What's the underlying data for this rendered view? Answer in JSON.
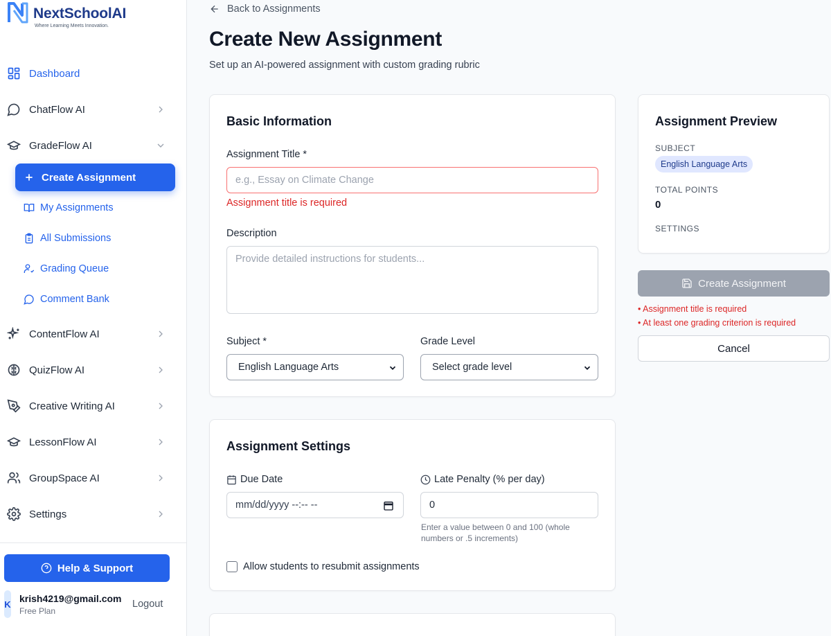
{
  "brand": {
    "name": "NextSchoolAI",
    "tagline": "Where Learning Meets Innovation."
  },
  "sidebar": {
    "items": [
      {
        "label": "Dashboard",
        "icon": "grid-icon"
      },
      {
        "label": "ChatFlow AI",
        "icon": "chat-bubble-icon"
      },
      {
        "label": "GradeFlow AI",
        "icon": "graduation-cap-icon"
      },
      {
        "label": "ContentFlow AI",
        "icon": "sparkles-icon"
      },
      {
        "label": "QuizFlow AI",
        "icon": "brain-icon"
      },
      {
        "label": "Creative Writing AI",
        "icon": "pen-tool-icon"
      },
      {
        "label": "LessonFlow AI",
        "icon": "graduation-cap-icon"
      },
      {
        "label": "GroupSpace AI",
        "icon": "users-icon"
      },
      {
        "label": "Settings",
        "icon": "gear-icon"
      }
    ],
    "subitems": [
      {
        "label": "Create Assignment",
        "icon": "plus-icon"
      },
      {
        "label": "My Assignments",
        "icon": "book-open-icon"
      },
      {
        "label": "All Submissions",
        "icon": "clipboard-icon"
      },
      {
        "label": "Grading Queue",
        "icon": "user-check-icon"
      },
      {
        "label": "Comment Bank",
        "icon": "chat-bubble-icon"
      }
    ],
    "help_label": "Help & Support",
    "user": {
      "avatar_letter": "K",
      "email": "krish4219@gmail.com",
      "plan": "Free Plan",
      "logout_label": "Logout"
    }
  },
  "header": {
    "back_label": "Back to Assignments",
    "title": "Create New Assignment",
    "subtitle": "Set up an AI-powered assignment with custom grading rubric"
  },
  "basic_info": {
    "title": "Basic Information",
    "title_label": "Assignment Title *",
    "title_placeholder": "e.g., Essay on Climate Change",
    "title_value": "",
    "title_error": "Assignment title is required",
    "description_label": "Description",
    "description_placeholder": "Provide detailed instructions for students...",
    "subject_label": "Subject *",
    "subject_value": "English Language Arts",
    "grade_label": "Grade Level",
    "grade_value": "Select grade level"
  },
  "settings": {
    "title": "Assignment Settings",
    "due_label": "Due Date",
    "due_placeholder": "mm/dd/yyyy --:-- --",
    "penalty_label": "Late Penalty (% per day)",
    "penalty_value": "0",
    "penalty_hint_1": "Enter a value between 0 and 100 (whole",
    "penalty_hint_2": "numbers or .5 increments)",
    "resubmit_label": "Allow students to resubmit assignments",
    "resubmit_checked": false
  },
  "preview": {
    "title": "Assignment Preview",
    "subject_label": "SUBJECT",
    "subject_value": "English Language Arts",
    "points_label": "TOTAL POINTS",
    "points_value": "0",
    "settings_label": "SETTINGS",
    "create_label": "Create Assignment",
    "errors": [
      "Assignment title is required",
      "At least one grading criterion is required"
    ],
    "cancel_label": "Cancel"
  },
  "colors": {
    "accent": "#2563eb",
    "error": "#dc2626",
    "disabled": "#9ca3af"
  }
}
